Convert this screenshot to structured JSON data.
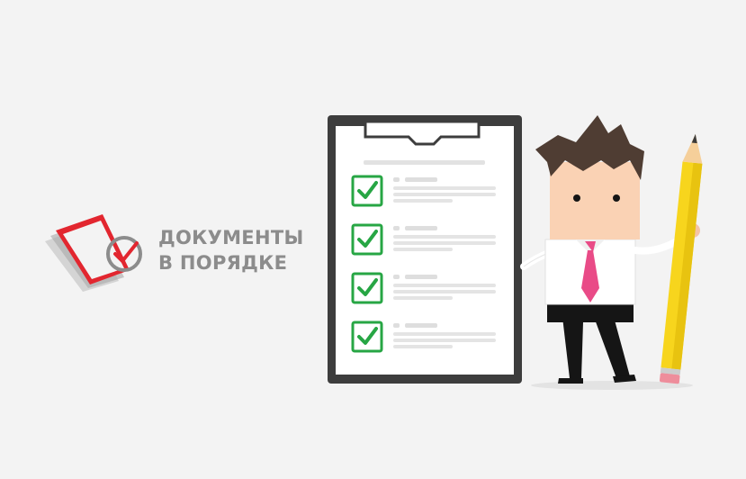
{
  "logo": {
    "line1": "ДОКУМЕНТЫ",
    "line2": "В ПОРЯДКЕ",
    "colors": {
      "accent": "#e2262f",
      "gray": "#8c8c8c"
    }
  },
  "clipboard": {
    "checklist_items": 4,
    "check_color": "#27a644"
  },
  "character": {
    "tie_color": "#e94b87",
    "pencil_color": "#f7d51d"
  }
}
